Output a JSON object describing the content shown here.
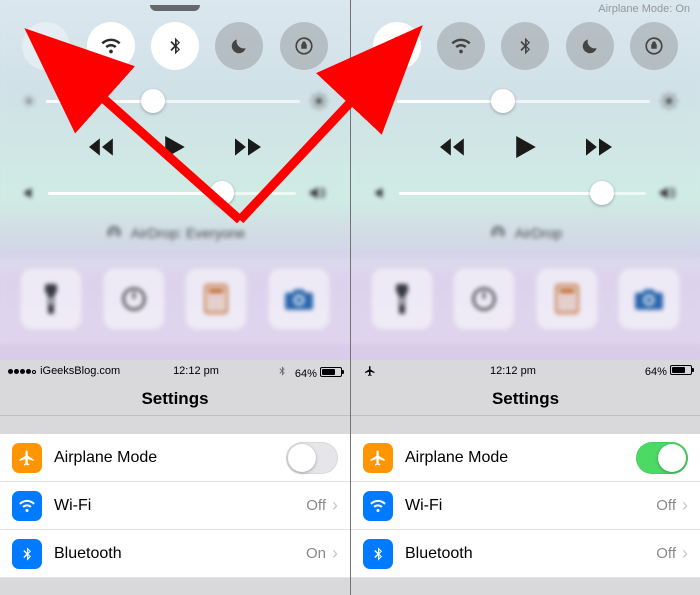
{
  "panes": [
    {
      "hint_visible": false,
      "hint_text": "",
      "toggles": {
        "airplane": false,
        "wifi": true,
        "bluetooth": true,
        "dnd": false,
        "rotation": false
      },
      "brightness_pct": 42,
      "volume_pct": 70,
      "airdrop_label": "AirDrop: Everyone",
      "status": {
        "carrier": "iGeeksBlog.com",
        "time": "12:12 pm",
        "battery_pct": 64,
        "battery_text": "64%",
        "airplane_icon": false
      },
      "settings_title": "Settings",
      "rows": {
        "airplane": {
          "label": "Airplane Mode",
          "on": false
        },
        "wifi": {
          "label": "Wi-Fi",
          "value": "Off"
        },
        "bluetooth": {
          "label": "Bluetooth",
          "value": "On"
        }
      }
    },
    {
      "hint_visible": true,
      "hint_text": "Airplane Mode: On",
      "toggles": {
        "airplane": true,
        "wifi": false,
        "bluetooth": false,
        "dnd": false,
        "rotation": false
      },
      "brightness_pct": 42,
      "volume_pct": 82,
      "airdrop_label": "AirDrop",
      "status": {
        "carrier": "",
        "time": "12:12 pm",
        "battery_pct": 64,
        "battery_text": "64%",
        "airplane_icon": true
      },
      "settings_title": "Settings",
      "rows": {
        "airplane": {
          "label": "Airplane Mode",
          "on": true
        },
        "wifi": {
          "label": "Wi-Fi",
          "value": "Off"
        },
        "bluetooth": {
          "label": "Bluetooth",
          "value": "Off"
        }
      }
    }
  ],
  "icons": {
    "airplane": "airplane-icon",
    "wifi": "wifi-icon",
    "bluetooth": "bluetooth-icon",
    "dnd": "moon-icon",
    "rotation": "rotation-lock-icon",
    "brightness_low": "brightness-low-icon",
    "brightness_high": "brightness-high-icon",
    "rewind": "rewind-icon",
    "play": "play-icon",
    "forward": "forward-icon",
    "vol_low": "volume-low-icon",
    "vol_high": "volume-high-icon",
    "airdrop": "airdrop-icon",
    "flashlight": "flashlight-icon",
    "timer": "timer-icon",
    "calculator": "calculator-icon",
    "camera": "camera-icon"
  }
}
